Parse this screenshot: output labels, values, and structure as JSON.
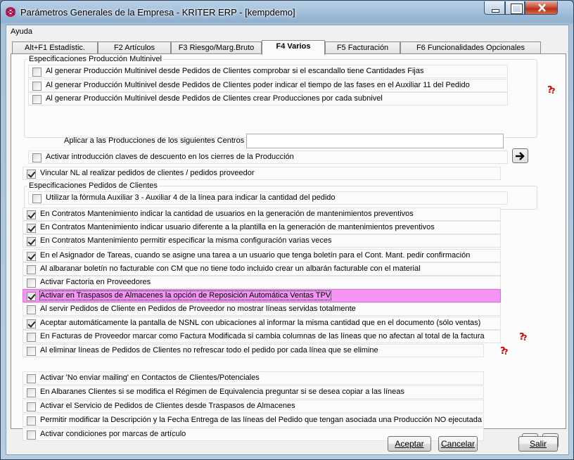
{
  "window": {
    "title": "Parámetros Generales de la Empresa - KRITER ERP - [kempdemo]"
  },
  "menu": {
    "ayuda": "Ayuda"
  },
  "tabs": [
    {
      "label": "Alt+F1 Estadístic."
    },
    {
      "label": "F2 Artículos"
    },
    {
      "label": "F3 Riesgo/Marg.Bruto"
    },
    {
      "label": "F4 Varios"
    },
    {
      "label": "F5 Facturación"
    },
    {
      "label": "F6 Funcionalidades Opcionales"
    }
  ],
  "active_tab": "F4 Varios",
  "group_multinivel": {
    "title": "Especificaciones Producción Multinivel",
    "rows": [
      {
        "label": "Al generar Producción Multinivel desde Pedidos de Clientes comprobar si el escandallo tiene Cantidades Fijas",
        "checked": false
      },
      {
        "label": "Al generar Producción Multinivel desde Pedidos de Clientes poder indicar el tiempo de las fases en el Auxiliar 11 del Pedido",
        "checked": false
      },
      {
        "label": "Al generar Producción Multinivel desde Pedidos de Clientes crear Producciones por cada subnivel",
        "checked": false
      }
    ],
    "centros_label": "Aplicar a las Producciones de los siguientes Centros",
    "centros_value": "",
    "descuento_row": {
      "label": "Activar introducción claves de descuento en los cierres de la Producción",
      "checked": false
    }
  },
  "row_vincular": {
    "label": "Vincular NL al realizar  pedidos de clientes /  pedidos proveedor",
    "checked": true
  },
  "group_pedidos": {
    "title": "Especificaciones Pedidos de Clientes",
    "row": {
      "label": "Utilizar la fórmula Auxiliar 3 - Auxiliar 4 de la línea para indicar la cantidad del pedido",
      "checked": false
    }
  },
  "options": [
    {
      "label": "En Contratos Mantenimiento indicar la cantidad de usuarios en la generación de mantenimientos preventivos",
      "checked": true
    },
    {
      "label": "En Contratos Mantenimiento indicar usuario diferente a la plantilla en la generación de mantenimientos preventivos",
      "checked": true
    },
    {
      "label": "En Contratos Mantenimiento permitir especificar la misma configuración varias veces",
      "checked": true
    },
    {
      "label": "En el Asignador de Tareas, cuando se asigne una tarea a un usuario que tenga boletín para el Cont. Mant. pedir confirmación",
      "checked": true
    },
    {
      "label": "Al albaranar boletín no facturable con CM que no tiene todo incluido crear un albarán facturable con el material",
      "checked": false
    },
    {
      "label": "Activar Factoria en Proveedores",
      "checked": false
    },
    {
      "label": "Activar en Traspasos de Almacenes la opción de Reposición Automática Ventas TPV",
      "checked": true,
      "highlighted": true
    },
    {
      "label": "Al servir Pedidos de Cliente en Pedidos de Proveedor no mostrar líneas servidas totalmente",
      "checked": false
    },
    {
      "label": "Aceptar automáticamente la pantalla de NSNL con ubicaciones al informar la misma cantidad que en el documento (sólo ventas)",
      "checked": true
    },
    {
      "label": "En Facturas de Proveedor marcar como Factura Modificada si cambia columnas de las líneas que no afectan al total de la factura",
      "checked": false
    },
    {
      "label": "Al eliminar líneas de Pedidos de Clientes no refrescar todo el pedido por cada línea que se elimine",
      "checked": false
    }
  ],
  "options_bottom": [
    {
      "label": "Activar 'No enviar mailing' en Contactos de Clientes/Potenciales",
      "checked": false
    },
    {
      "label": "En Albaranes Clientes si se modifica el Régimen de Equivalencia preguntar si se desea copiar a las líneas",
      "checked": false
    },
    {
      "label": "Activar el Servicio de Pedidos de Clientes desde Traspasos de Almacenes",
      "checked": false
    },
    {
      "label": "Permitir modificar la Descripción y la Fecha Entrega de las líneas del Pedido que tengan asociada una Producción NO ejecutada",
      "checked": false
    },
    {
      "label": "Activar condiciones por marcas de artículo",
      "checked": false
    }
  ],
  "buttons": {
    "aceptar": "Aceptar",
    "cancelar": "Cancelar",
    "salir": "Salir"
  },
  "colors": {
    "highlight": "#f494f4",
    "titlebar": "#a9c2da",
    "panel": "#fcfcfc"
  },
  "icons": {
    "help": "help-question-icon",
    "next": "arrow-right-icon",
    "prev": "arrow-left-icon"
  }
}
